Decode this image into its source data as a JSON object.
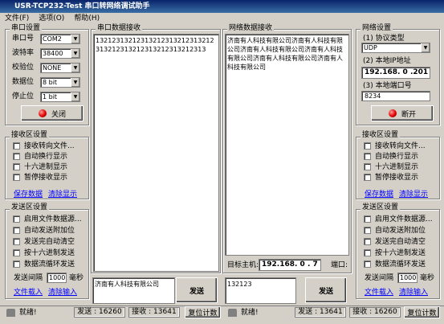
{
  "window": {
    "title": "USR-TCP232-Test  串口转网络调试助手"
  },
  "menu": [
    "文件(F)",
    "选项(O)",
    "帮助(H)"
  ],
  "serial_settings": {
    "title": "串口设置",
    "rows": [
      {
        "label": "串口号",
        "value": "COM2"
      },
      {
        "label": "波特率",
        "value": "38400"
      },
      {
        "label": "校验位",
        "value": "NONE"
      },
      {
        "label": "数据位",
        "value": "8 bit"
      },
      {
        "label": "停止位",
        "value": "1 bit"
      }
    ],
    "close_button": "关闭"
  },
  "left_receive": {
    "title": "接收区设置",
    "options": [
      "接收转向文件...",
      "自动换行显示",
      "十六进制显示",
      "暂停接收显示"
    ],
    "save": "保存数据",
    "clear": "清除显示"
  },
  "left_send": {
    "title": "发送区设置",
    "options": [
      "启用文件数据源...",
      "自动发送附加位",
      "发送完自动清空",
      "按十六进制发送",
      "数据流循环发送"
    ],
    "interval_label": "发送间隔",
    "interval_value": "1000",
    "interval_unit": "毫秒",
    "load_file": "文件载入",
    "clear_input": "清除输入"
  },
  "serial_receive": {
    "title": "串口数据接收",
    "content": "13212313212313212313212313212313212313212313212313212313"
  },
  "net_receive": {
    "title": "网络数据接收",
    "content": "济南有人科技有限公司济南有人科技有限公司济南有人科技有限公司济南有人科技有限公司济南有人科技有限公司济南有人科技有限公司"
  },
  "target": {
    "label": "目标主机:",
    "ip": "192.168. 0 . 7",
    "port_label": "端口:"
  },
  "serial_send": {
    "content": "济南有人科技有限公司",
    "button": "发送"
  },
  "net_send": {
    "content": "132123",
    "button": "发送"
  },
  "net_settings": {
    "title": "网络设置",
    "protocol_label": "(1) 协议类型",
    "protocol_value": "UDP",
    "ip_label": "(2) 本地IP地址",
    "ip_value": "192.168. 0 .201",
    "port_label": "(3) 本地端口号",
    "port_value": "8234",
    "open_button": "断开"
  },
  "right_receive": {
    "title": "接收区设置",
    "options": [
      "接收转向文件...",
      "自动换行显示",
      "十六进制显示",
      "暂停接收显示"
    ],
    "save": "保存数据",
    "clear": "清除显示"
  },
  "right_send": {
    "title": "发送区设置",
    "options": [
      "启用文件数据源...",
      "自动发送附加位",
      "发送完自动清空",
      "按十六进制发送",
      "数据流循环发送"
    ],
    "interval_label": "发送间隔",
    "interval_value": "1000",
    "interval_unit": "毫秒",
    "load_file": "文件载入",
    "clear_input": "清除输入"
  },
  "status_left": {
    "ready": "就绪!",
    "sent": "发送 : 16260",
    "received": "接收 : 13641",
    "reset": "复位计数"
  },
  "status_right": {
    "ready": "就绪!",
    "sent": "发送 : 13641",
    "received": "接收 : 16260",
    "reset": "复位计数"
  }
}
